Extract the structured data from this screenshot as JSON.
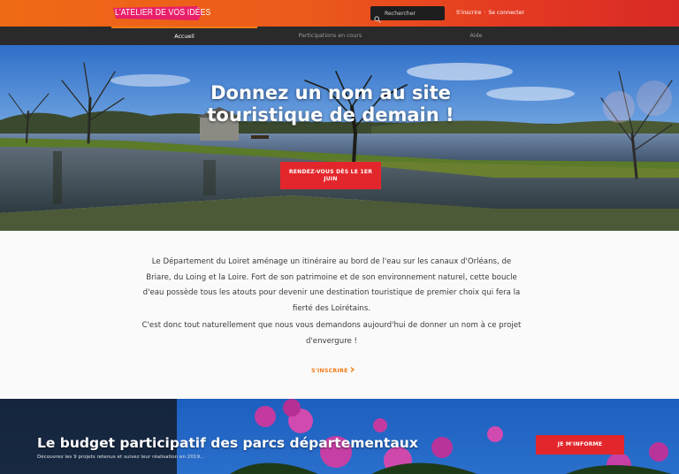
{
  "header": {
    "logo_text": "L'Atelier de vos idées",
    "search_placeholder": "Rechercher",
    "signup_label": "S'inscrire",
    "separator": "·",
    "login_label": "Se connecter"
  },
  "nav": {
    "items": [
      {
        "label": "Accueil",
        "active": true
      },
      {
        "label": "Participations en cours",
        "active": false
      },
      {
        "label": "Aide",
        "active": false
      }
    ]
  },
  "hero": {
    "title_line1": "Donnez un nom au site",
    "title_line2": "touristique de demain !",
    "cta_line1": "RENDEZ-VOUS DÈS LE 1ER",
    "cta_line2": "JUIN"
  },
  "intro": {
    "paragraph1": "Le Département du Loiret aménage un itinéraire au bord de l'eau sur les canaux d'Orléans, de Briare, du Loing et la Loire. Fort de son patrimoine et de son environnement naturel, cette boucle d'eau possède tous les atouts pour devenir une destination touristique de premier choix qui fera la fierté des Loirétains.",
    "paragraph2": "C'est donc tout naturellement que nous vous demandons aujourd'hui de donner un nom à ce projet d'envergure !",
    "cta_label": "S'INSCRIRE",
    "cta_icon": "chevron-right-icon"
  },
  "budget": {
    "title": "Le budget participatif des parcs départementaux",
    "subtitle": "Découvrez les 9 projets retenus et suivez leur réalisation en 2019...",
    "cta_label": "JE M'INFORME"
  },
  "colors": {
    "accent_orange": "#f07a13",
    "cta_red": "#e3262b",
    "nav_bg": "#2a2a2a",
    "header_gradient_start": "#ef6a16",
    "header_gradient_end": "#d92a25"
  }
}
